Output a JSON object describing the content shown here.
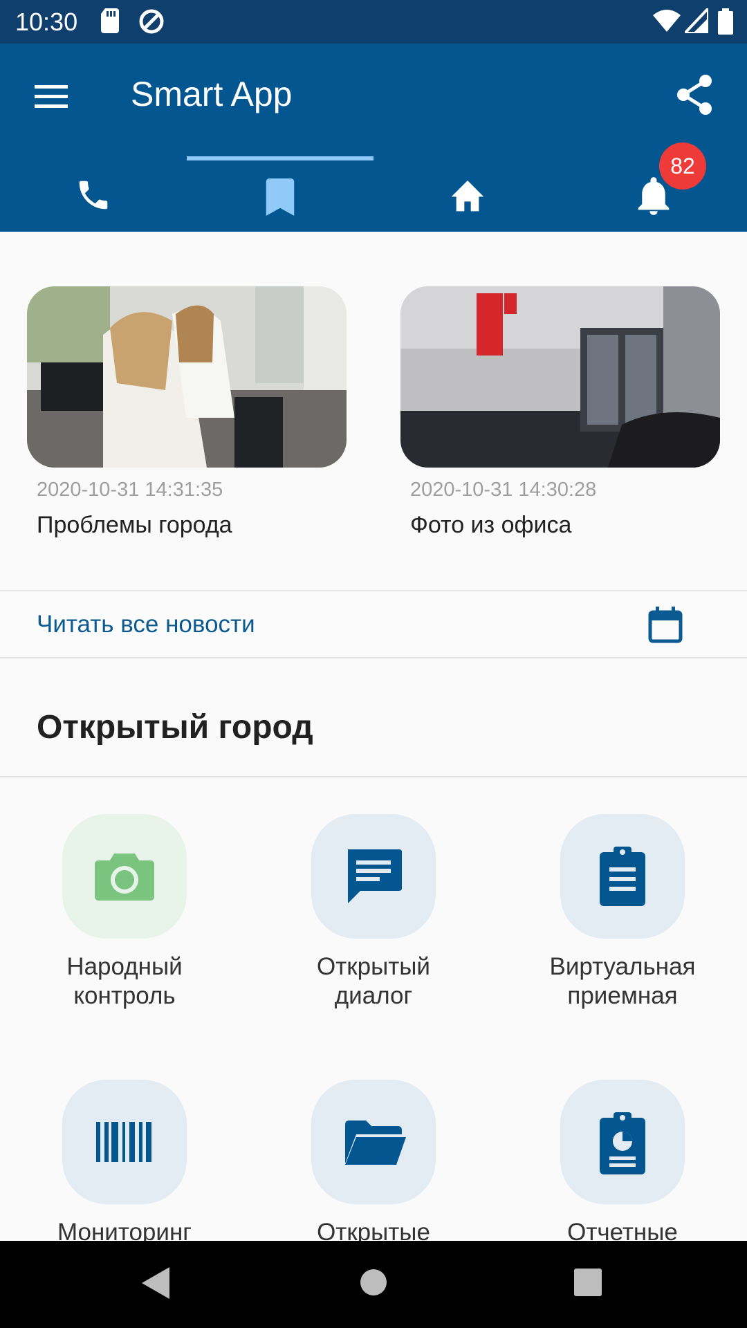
{
  "status_bar": {
    "time": "10:30",
    "left_icons": [
      "sd-card-icon",
      "sync-icon"
    ],
    "right_icons": [
      "wifi-icon",
      "signal-icon",
      "battery-icon"
    ]
  },
  "app_bar": {
    "title": "Smart App",
    "menu_icon": "menu-icon",
    "share_icon": "share-icon"
  },
  "tabs": [
    {
      "name": "phone",
      "icon": "phone-icon"
    },
    {
      "name": "bookmark",
      "icon": "bookmark-icon",
      "selected": true
    },
    {
      "name": "home",
      "icon": "home-icon"
    },
    {
      "name": "notifications",
      "icon": "bell-icon",
      "badge": "82"
    }
  ],
  "news": [
    {
      "date": "2020-10-31 14:31:35",
      "title": "Проблемы города"
    },
    {
      "date": "2020-10-31 14:30:28",
      "title": "Фото из офиса"
    }
  ],
  "read_all": {
    "label": "Читать все новости",
    "icon": "calendar-icon"
  },
  "section": {
    "title": "Открытый город"
  },
  "services": [
    {
      "line1": "Народный",
      "line2": "контроль",
      "icon": "camera-icon"
    },
    {
      "line1": "Открытый",
      "line2": "диалог",
      "icon": "message-icon"
    },
    {
      "line1": "Виртуальная",
      "line2": "приемная",
      "icon": "clipboard-icon"
    },
    {
      "line1": "Мониторинг",
      "line2": "",
      "icon": "barcode-icon"
    },
    {
      "line1": "Открытые",
      "line2": "",
      "icon": "folder-icon"
    },
    {
      "line1": "Отчетные",
      "line2": "",
      "icon": "report-icon"
    }
  ],
  "colors": {
    "status_bar": "#0f3f6d",
    "app_bar": "#045691",
    "accent": "#0b5a91",
    "tab_indicator": "#90caf9",
    "badge": "#ef3a3a",
    "service_bg": "#e3ebf3",
    "service_bg_green": "#e8f3ea",
    "camera_green": "#7ac47f"
  },
  "nav": [
    "back-icon",
    "home-circle-icon",
    "recents-icon"
  ]
}
